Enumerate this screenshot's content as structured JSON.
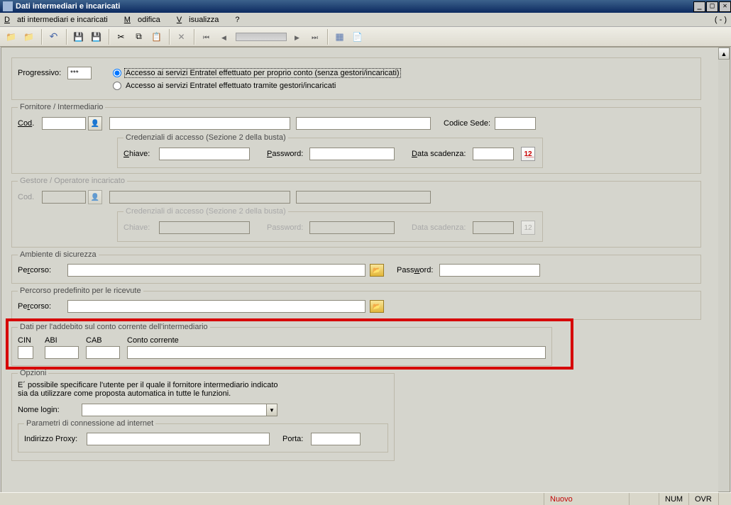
{
  "window": {
    "title": "Dati intermediari e incaricati",
    "paren": "( - )"
  },
  "menu": {
    "item1_pre": "D",
    "item1_rest": "ati intermediari e incaricati",
    "item2_pre": "M",
    "item2_rest": "odifica",
    "item3_pre": "V",
    "item3_rest": "isualizza",
    "item4": "?"
  },
  "form": {
    "progressivo_label": "Progressivo:",
    "progressivo_value": "***",
    "radio1": "Accesso ai servizi Entratel effettuato per proprio conto (senza gestori/incaricati)",
    "radio2": "Accesso  ai  servizi  Entratel  effettuato  tramite  gestori/incaricati"
  },
  "fornitore": {
    "legend": "Fornitore / Intermediario",
    "cod_pre": "Cod",
    "cod_rest": ".",
    "codsede": "Codice Sede:",
    "cred_legend": "Credenziali di accesso (Sezione 2 della busta)",
    "chiave_pre": "C",
    "chiave_rest": "hiave:",
    "password_pre": "P",
    "password_rest": "assword:",
    "data_pre": "D",
    "data_rest": "ata scadenza:"
  },
  "gestore": {
    "legend": "Gestore / Operatore incaricato",
    "cod": "Cod.",
    "cred_legend": "Credenziali di accesso (Sezione 2 della busta)",
    "chiave": "Chiave:",
    "password": "Password:",
    "data": "Data scadenza:"
  },
  "ambiente": {
    "legend": "Ambiente di sicurezza",
    "percorso_pre": "Pe",
    "percorso_rest": "rcorso:",
    "password_pre": "Pass",
    "password_rest": "word:",
    "password_ul": "w"
  },
  "ricevute": {
    "legend": "Percorso predefinito per le ricevute",
    "percorso_pre": "Pe",
    "percorso_rest": "rcorso:"
  },
  "addebito": {
    "legend": "Dati per l'addebito sul conto corrente dell'intermediario",
    "cin": "CIN",
    "abi": "ABI",
    "cab": "CAB",
    "cc": "Conto corrente"
  },
  "opzioni": {
    "legend": "Opzioni",
    "desc1": "E´ possibile  specificare  l'utente  per  il  quale  il fornitore  intermediario indicato",
    "desc2": "sia da utilizzare  come proposta automatica  in tutte  le funzioni.",
    "nome": "Nome login:",
    "param_legend": "Parametri di connessione ad internet",
    "proxy": "Indirizzo Proxy:",
    "porta": "Porta:"
  },
  "status": {
    "nuovo": "Nuovo",
    "num": "NUM",
    "ovr": "OVR"
  }
}
